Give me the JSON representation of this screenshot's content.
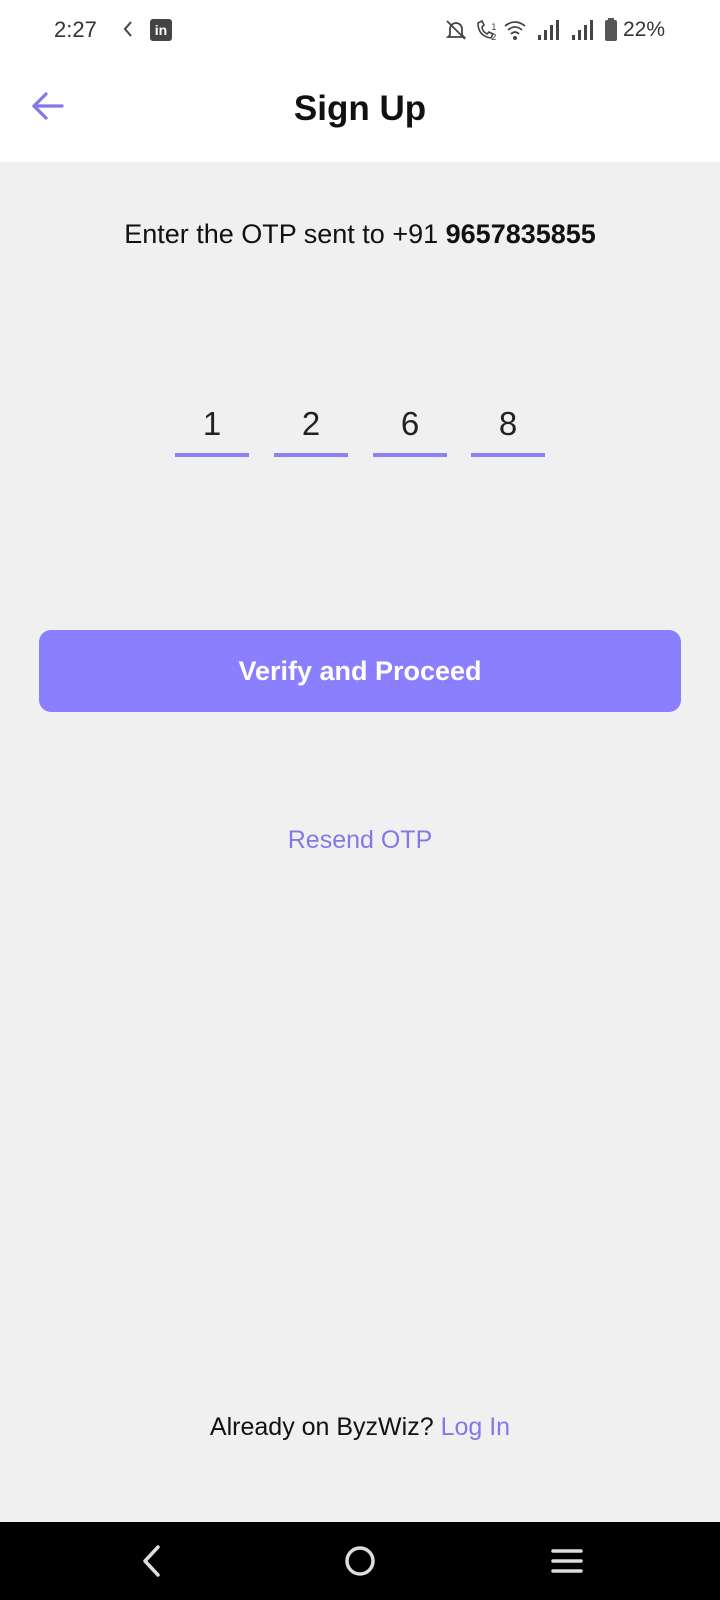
{
  "status_bar": {
    "time": "2:27",
    "battery": "22%",
    "icons": [
      "moon-icon",
      "linkedin-icon",
      "mute-icon",
      "wifi-call-icon",
      "wifi-icon",
      "signal-icon",
      "signal-icon",
      "battery-icon"
    ]
  },
  "header": {
    "title": "Sign Up",
    "back_icon": "arrow-left-icon"
  },
  "otp": {
    "prompt_prefix": "Enter the OTP sent to +91 ",
    "phone": "9657835855",
    "digits": [
      "1",
      "2",
      "6",
      "8"
    ]
  },
  "actions": {
    "verify_label": "Verify and Proceed",
    "resend_label": "Resend OTP"
  },
  "footer": {
    "prefix": "Already on ByzWiz? ",
    "login_label": "Log In"
  },
  "nav": {
    "back": "back-nav-icon",
    "home": "home-nav-icon",
    "recents": "recents-nav-icon"
  },
  "colors": {
    "accent": "#8a80ff",
    "link": "#8478e8",
    "background": "#f0f0f0"
  }
}
